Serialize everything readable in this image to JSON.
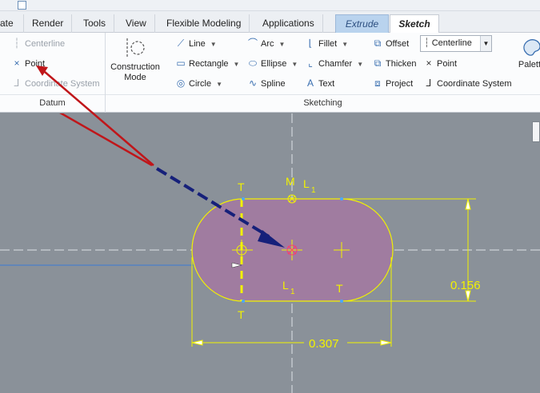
{
  "tabs": [
    {
      "label": "ate"
    },
    {
      "label": "Render"
    },
    {
      "label": "Tools"
    },
    {
      "label": "View"
    },
    {
      "label": "Flexible Modeling"
    },
    {
      "label": "Applications"
    },
    {
      "label": "Extrude"
    },
    {
      "label": "Sketch"
    }
  ],
  "datum": {
    "centerline": "Centerline",
    "point": "Point",
    "coordinate_system": "Coordinate System",
    "group_label": "Datum"
  },
  "construction_mode": {
    "line1": "Construction",
    "line2": "Mode"
  },
  "sketching": {
    "line": "Line",
    "rectangle": "Rectangle",
    "circle": "Circle",
    "arc": "Arc",
    "ellipse": "Ellipse",
    "spline": "Spline",
    "fillet": "Fillet",
    "chamfer": "Chamfer",
    "text": "Text",
    "offset": "Offset",
    "thicken": "Thicken",
    "project": "Project",
    "centerline_select": "Centerline",
    "point": "Point",
    "coordinate_system": "Coordinate System",
    "palette": "Palette",
    "group_label": "Sketching"
  },
  "sketch": {
    "dim_width": "0.307",
    "dim_height": "0.156",
    "constraint_T": "T",
    "constraint_M": "M",
    "constraint_L": "L",
    "constraint_L_sub": "1",
    "colors": {
      "shape_fill": "#a07ca0",
      "sketch_line": "#f2f200",
      "arrow_red": "#c0161a",
      "arrow_blue": "#16207a"
    }
  }
}
